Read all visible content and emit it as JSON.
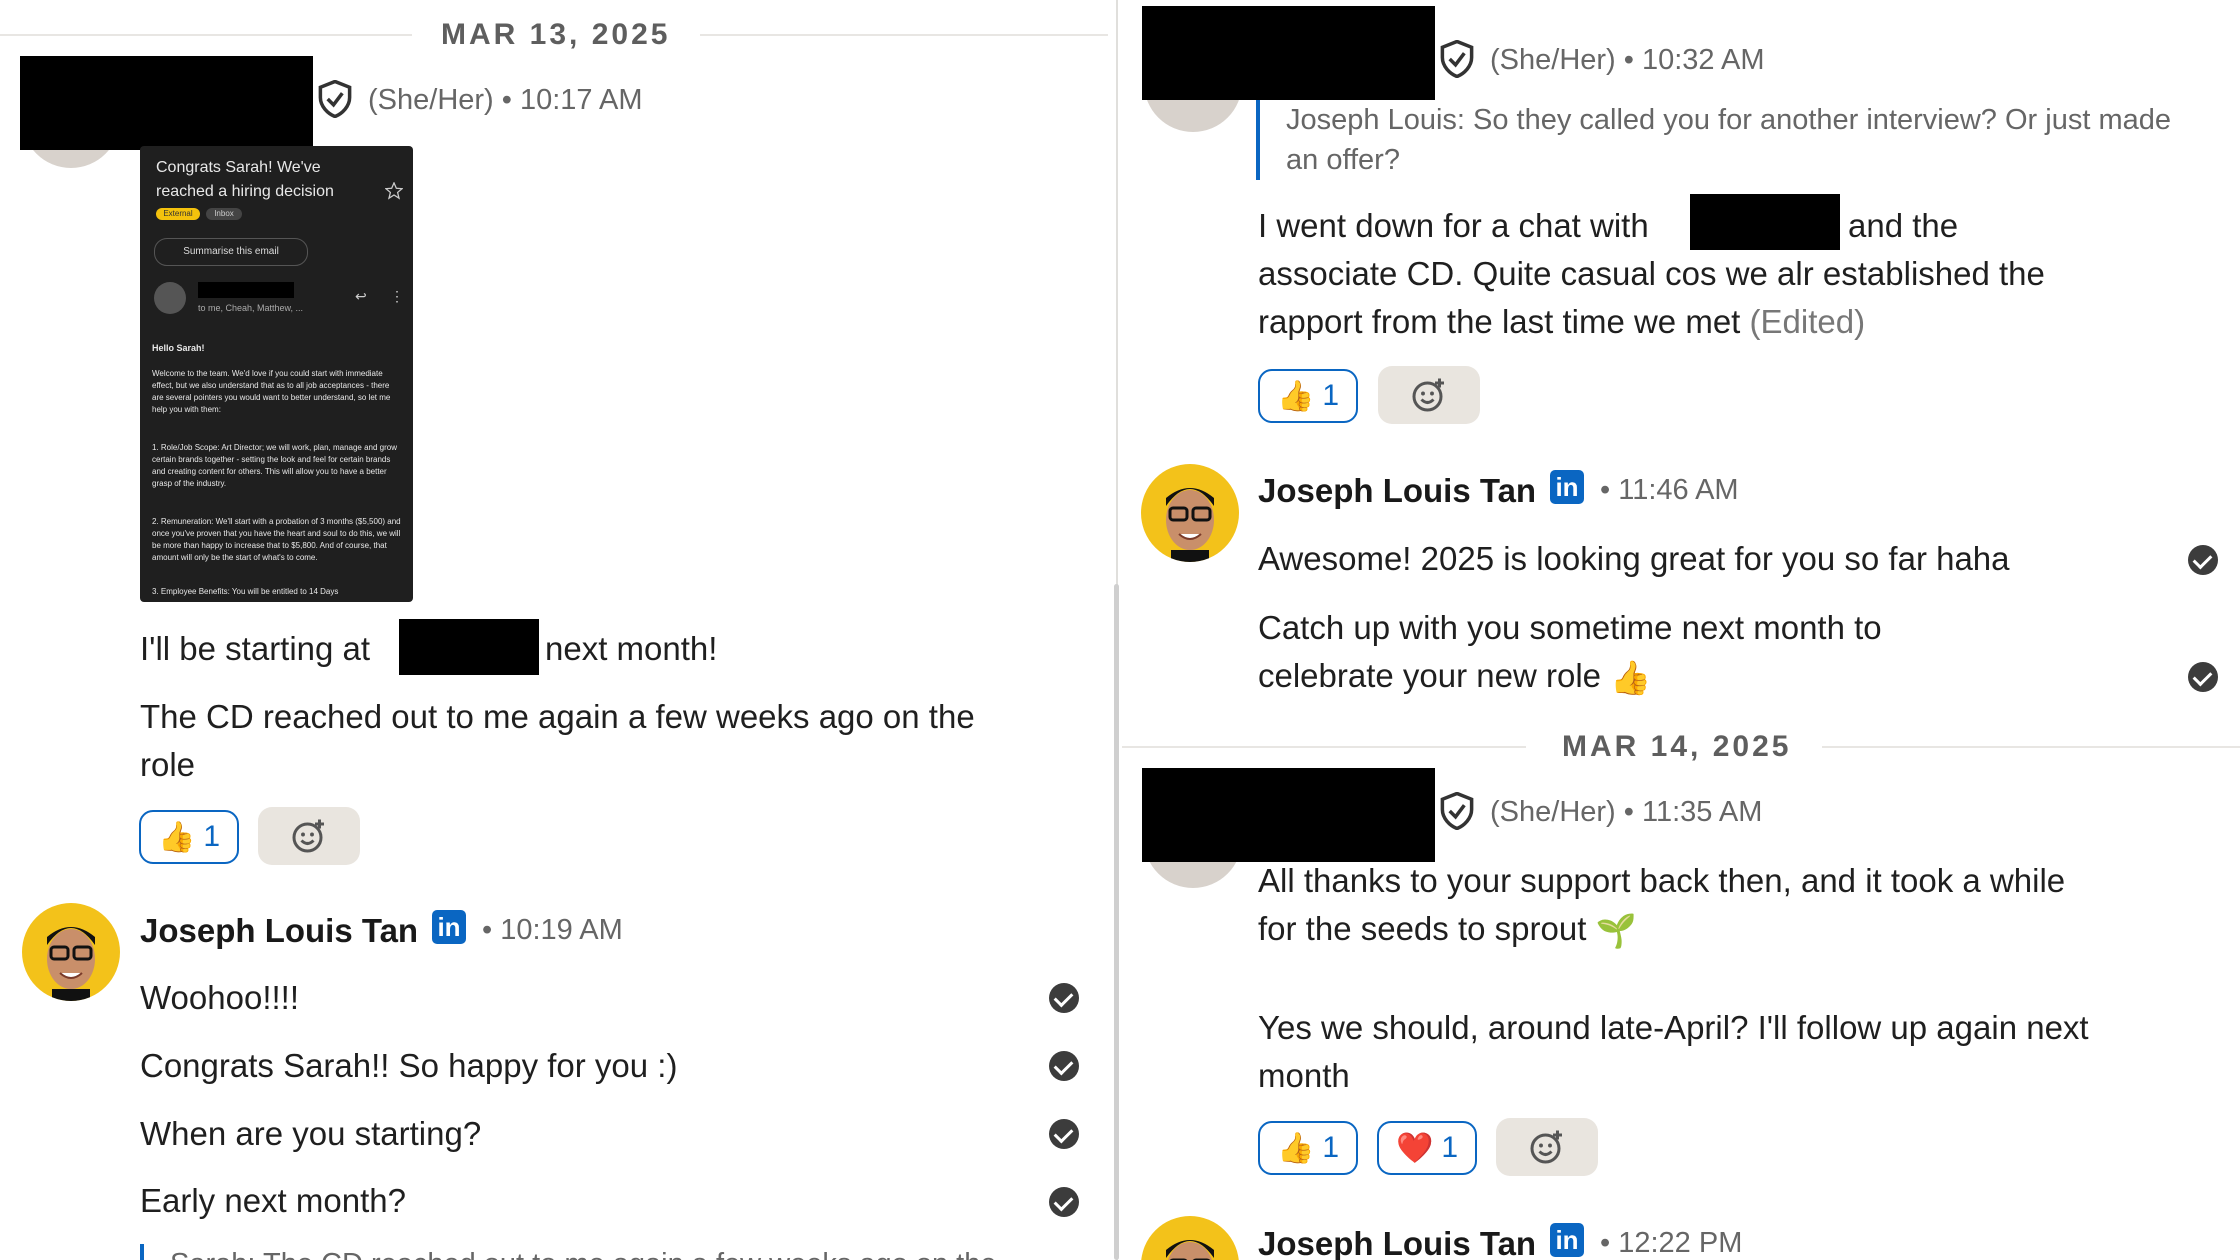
{
  "left": {
    "date": "MAR 13, 2025",
    "msg1": {
      "pronouns": "(She/Her)",
      "time": "10:17 AM",
      "attachment": {
        "title": "Congrats Sarah! We've reached a hiring decision",
        "tag1": "External",
        "tag2": "Inbox",
        "summarise": "Summarise this email",
        "to_line": "to me, Cheah, Matthew, ...",
        "greeting": "Hello Sarah!",
        "b1": "Welcome to the team. We'd love if you could start with immediate effect, but we also understand that as to all job acceptances - there are several pointers you would want to better understand, so let me help you with them:",
        "b2": "1. Role/Job Scope: Art Director; we will work, plan, manage and grow certain brands together - setting the look and feel for certain brands and creating content for others. This will allow you to have a better grasp of the industry.",
        "b3": "2. Remuneration: We'll start with a probation of 3 months ($5,500) and once you've proven that you have the heart and soul to do this, we will be more than happy to increase that to $5,800. And of course, that amount will only be the start of what's to come.",
        "b4": "3. Employee Benefits: You will be entitled to 14 Days"
      },
      "line1_pre": "I'll be starting at",
      "line1_post": "next month!",
      "line2": "The CD reached out to me again a few weeks ago on the role",
      "reaction_count": "1"
    },
    "msg2": {
      "name": "Joseph Louis Tan",
      "time": "10:19 AM",
      "lines": [
        "Woohoo!!!!",
        "Congrats Sarah!! So happy for you :)",
        "When are you starting?",
        "Early next month?"
      ],
      "quote": "Sarah: The CD reached out to me again a few weeks ago on the"
    }
  },
  "right": {
    "msg1": {
      "pronouns": "(She/Her)",
      "time": "10:32 AM",
      "quote": "Joseph Louis: So they called you for another interview? Or just made an offer?",
      "text_pre": "I went down for a chat with",
      "text_post": "and the associate CD. Quite casual cos we alr established the rapport from the last time we met",
      "edited": "(Edited)",
      "reaction_count": "1"
    },
    "msg2": {
      "name": "Joseph Louis Tan",
      "time": "11:46 AM",
      "line1": "Awesome! 2025 is looking great for you so far haha",
      "line2": "Catch up with you sometime next month to celebrate your new role"
    },
    "date": "MAR 14, 2025",
    "msg3": {
      "pronouns": "(She/Her)",
      "time": "11:35 AM",
      "para1": "All thanks to your support back then, and it took a while for the seeds to sprout",
      "para2": "Yes we should, around late-April? I'll follow up again next month",
      "thumbs_count": "1",
      "heart_count": "1"
    },
    "msg4": {
      "name": "Joseph Louis Tan",
      "time": "12:22 PM"
    }
  },
  "meta": {
    "dot": "•",
    "linkedin_badge": "in"
  },
  "colors": {
    "accent": "#0a66c2",
    "avatar_yellow": "#f3c21a",
    "reaction_bg": "#e9e5df"
  },
  "icons": [
    "verified-shield-icon",
    "linkedin-icon",
    "read-check-icon",
    "thumbs-up-icon",
    "heart-icon",
    "add-reaction-icon",
    "seedling-icon",
    "star-icon",
    "reply-icon",
    "more-icon"
  ]
}
